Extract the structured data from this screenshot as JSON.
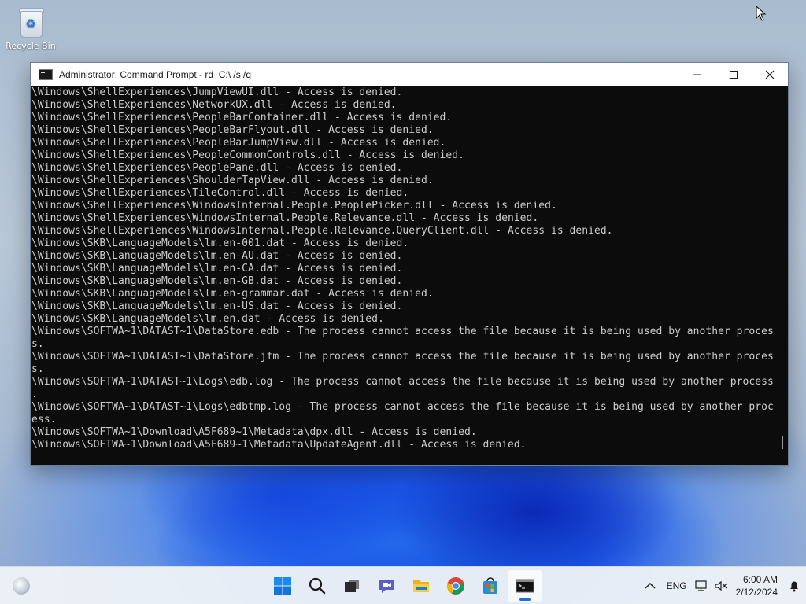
{
  "desktop": {
    "recycle_bin_label": "Recycle Bin"
  },
  "window": {
    "title": "Administrator: Command Prompt - rd  C:\\ /s /q",
    "controls": [
      "minimize",
      "maximize",
      "close"
    ]
  },
  "console": {
    "lines": [
      "\\Windows\\ShellExperiences\\JumpViewUI.dll - Access is denied.",
      "\\Windows\\ShellExperiences\\NetworkUX.dll - Access is denied.",
      "\\Windows\\ShellExperiences\\PeopleBarContainer.dll - Access is denied.",
      "\\Windows\\ShellExperiences\\PeopleBarFlyout.dll - Access is denied.",
      "\\Windows\\ShellExperiences\\PeopleBarJumpView.dll - Access is denied.",
      "\\Windows\\ShellExperiences\\PeopleCommonControls.dll - Access is denied.",
      "\\Windows\\ShellExperiences\\PeoplePane.dll - Access is denied.",
      "\\Windows\\ShellExperiences\\ShoulderTapView.dll - Access is denied.",
      "\\Windows\\ShellExperiences\\TileControl.dll - Access is denied.",
      "\\Windows\\ShellExperiences\\WindowsInternal.People.PeoplePicker.dll - Access is denied.",
      "\\Windows\\ShellExperiences\\WindowsInternal.People.Relevance.dll - Access is denied.",
      "\\Windows\\ShellExperiences\\WindowsInternal.People.Relevance.QueryClient.dll - Access is denied.",
      "\\Windows\\SKB\\LanguageModels\\lm.en-001.dat - Access is denied.",
      "\\Windows\\SKB\\LanguageModels\\lm.en-AU.dat - Access is denied.",
      "\\Windows\\SKB\\LanguageModels\\lm.en-CA.dat - Access is denied.",
      "\\Windows\\SKB\\LanguageModels\\lm.en-GB.dat - Access is denied.",
      "\\Windows\\SKB\\LanguageModels\\lm.en-grammar.dat - Access is denied.",
      "\\Windows\\SKB\\LanguageModels\\lm.en-US.dat - Access is denied.",
      "\\Windows\\SKB\\LanguageModels\\lm.en.dat - Access is denied.",
      "\\Windows\\SOFTWA~1\\DATAST~1\\DataStore.edb - The process cannot access the file because it is being used by another proces",
      "s.",
      "\\Windows\\SOFTWA~1\\DATAST~1\\DataStore.jfm - The process cannot access the file because it is being used by another proces",
      "s.",
      "\\Windows\\SOFTWA~1\\DATAST~1\\Logs\\edb.log - The process cannot access the file because it is being used by another process",
      ".",
      "\\Windows\\SOFTWA~1\\DATAST~1\\Logs\\edbtmp.log - The process cannot access the file because it is being used by another proc",
      "ess.",
      "\\Windows\\SOFTWA~1\\Download\\A5F689~1\\Metadata\\dpx.dll - Access is denied.",
      "\\Windows\\SOFTWA~1\\Download\\A5F689~1\\Metadata\\UpdateAgent.dll - Access is denied."
    ]
  },
  "taskbar": {
    "apps": [
      {
        "name": "start",
        "icon": "windows-logo-icon"
      },
      {
        "name": "search",
        "icon": "search-icon"
      },
      {
        "name": "task-view",
        "icon": "task-view-icon"
      },
      {
        "name": "chat",
        "icon": "chat-icon"
      },
      {
        "name": "file-explorer",
        "icon": "folder-icon"
      },
      {
        "name": "chrome",
        "icon": "chrome-icon"
      },
      {
        "name": "store",
        "icon": "store-icon"
      },
      {
        "name": "command-prompt",
        "icon": "terminal-icon",
        "active": true
      }
    ],
    "language": "ENG",
    "time": "6:00 AM",
    "date": "2/12/2024",
    "accent_color": "#1a6fd8"
  }
}
